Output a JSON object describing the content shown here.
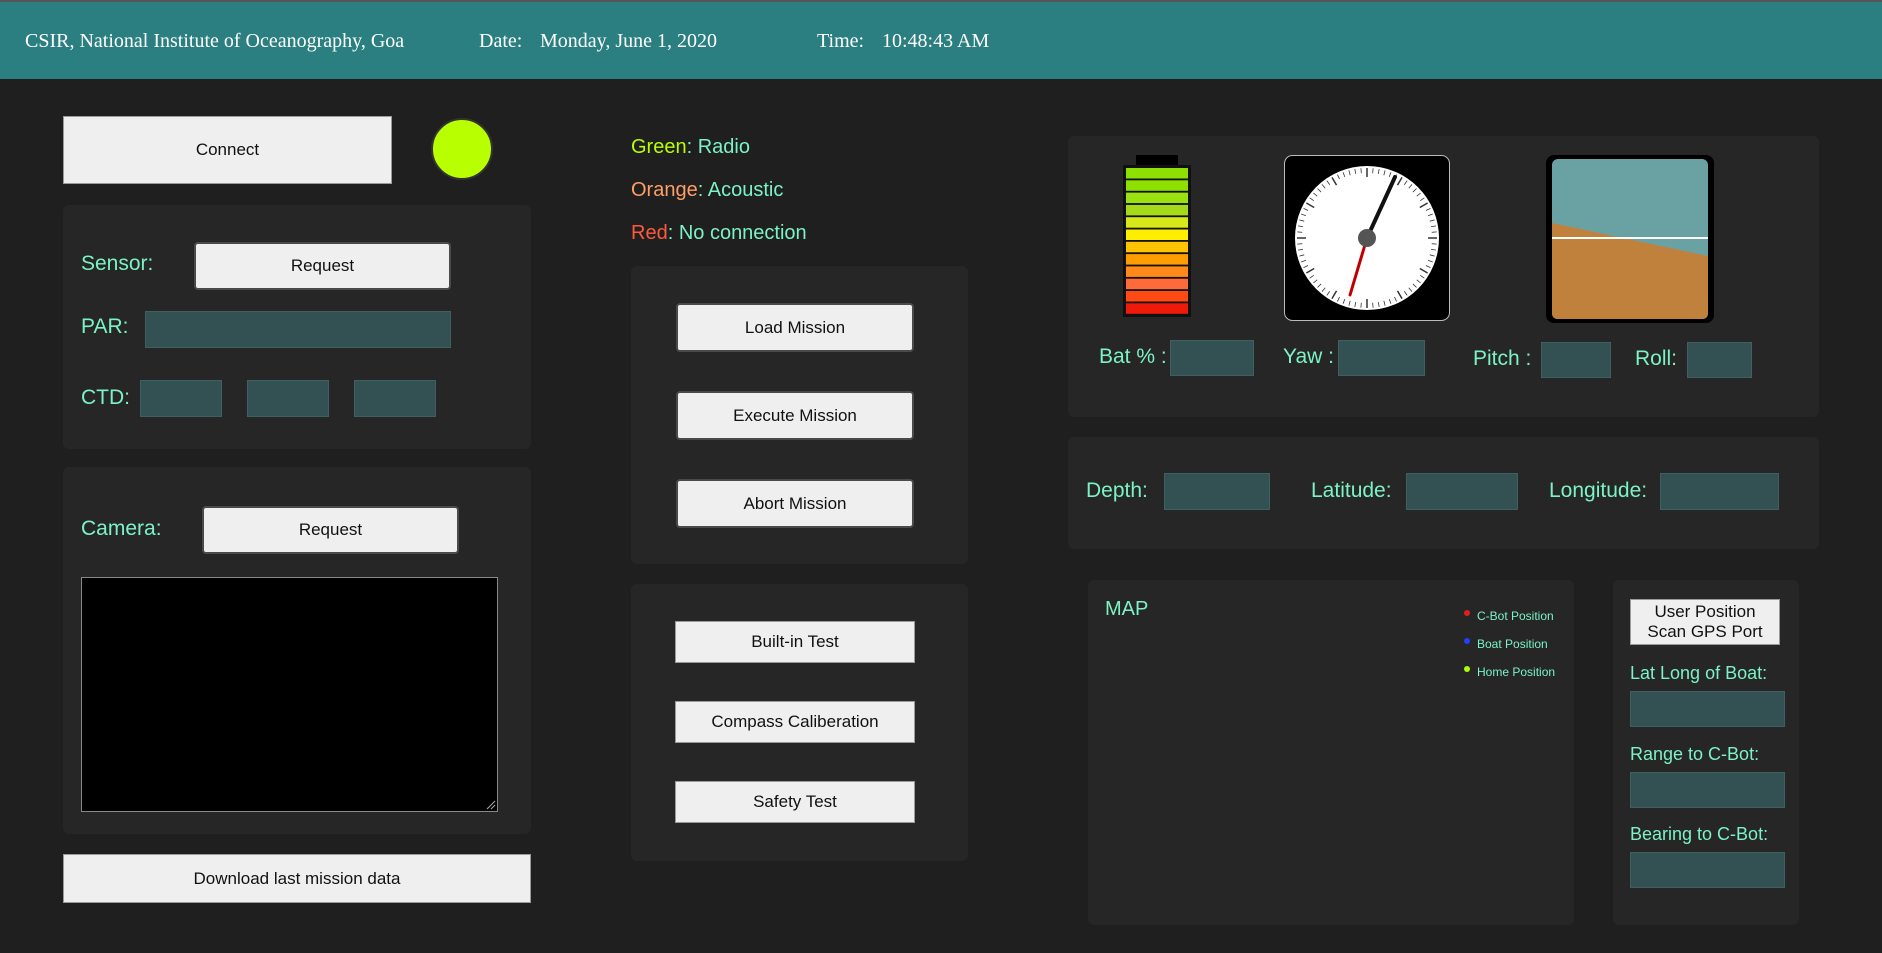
{
  "header": {
    "organization": "CSIR, National Institute of Oceanography, Goa",
    "date_label": "Date:",
    "date_value": "Monday, June 1, 2020",
    "time_label": "Time:",
    "time_value": "10:48:43 AM"
  },
  "connection": {
    "connect_label": "Connect",
    "status_color": "#b8ff00"
  },
  "sensor": {
    "sensor_label": "Sensor:",
    "request_label": "Request",
    "par_label": "PAR:",
    "par_value": "",
    "ctd_label": "CTD:",
    "ctd_values": [
      "",
      "",
      ""
    ]
  },
  "camera": {
    "camera_label": "Camera:",
    "request_label": "Request"
  },
  "download_label": "Download last mission data",
  "legend": {
    "green_word": "Green",
    "green_meaning": ": Radio",
    "orange_word": "Orange",
    "orange_meaning": ": Acoustic",
    "red_word": "Red",
    "red_meaning": ": No connection",
    "colors": {
      "green": "#b8ff00",
      "orange": "#ff9e66",
      "red": "#ff5a3c"
    }
  },
  "mission": {
    "load": "Load Mission",
    "execute": "Execute Mission",
    "abort": "Abort Mission"
  },
  "tests": {
    "builtin": "Built-in Test",
    "compass": "Compass Caliberation",
    "safety": "Safety Test"
  },
  "instruments": {
    "bat_label": "Bat % :",
    "bat_value": "",
    "yaw_label": "Yaw :",
    "yaw_value": "",
    "pitch_label": "Pitch :",
    "pitch_value": "",
    "roll_label": "Roll:",
    "roll_value": ""
  },
  "position": {
    "depth_label": "Depth:",
    "depth_value": "",
    "latitude_label": "Latitude:",
    "latitude_value": "",
    "longitude_label": "Longitude:",
    "longitude_value": ""
  },
  "map": {
    "title": "MAP",
    "legend": [
      {
        "label": "C-Bot Position",
        "color": "#e02020"
      },
      {
        "label": "Boat Position",
        "color": "#2040ff"
      },
      {
        "label": "Home Position",
        "color": "#a8ff00"
      }
    ]
  },
  "gps": {
    "user_position_label": "User Position",
    "scan_port_label": "Scan GPS Port",
    "lat_long_label": "Lat Long of Boat:",
    "lat_long_value": "",
    "range_label": "Range to C-Bot:",
    "range_value": "",
    "bearing_label": "Bearing to C-Bot:",
    "bearing_value": ""
  }
}
